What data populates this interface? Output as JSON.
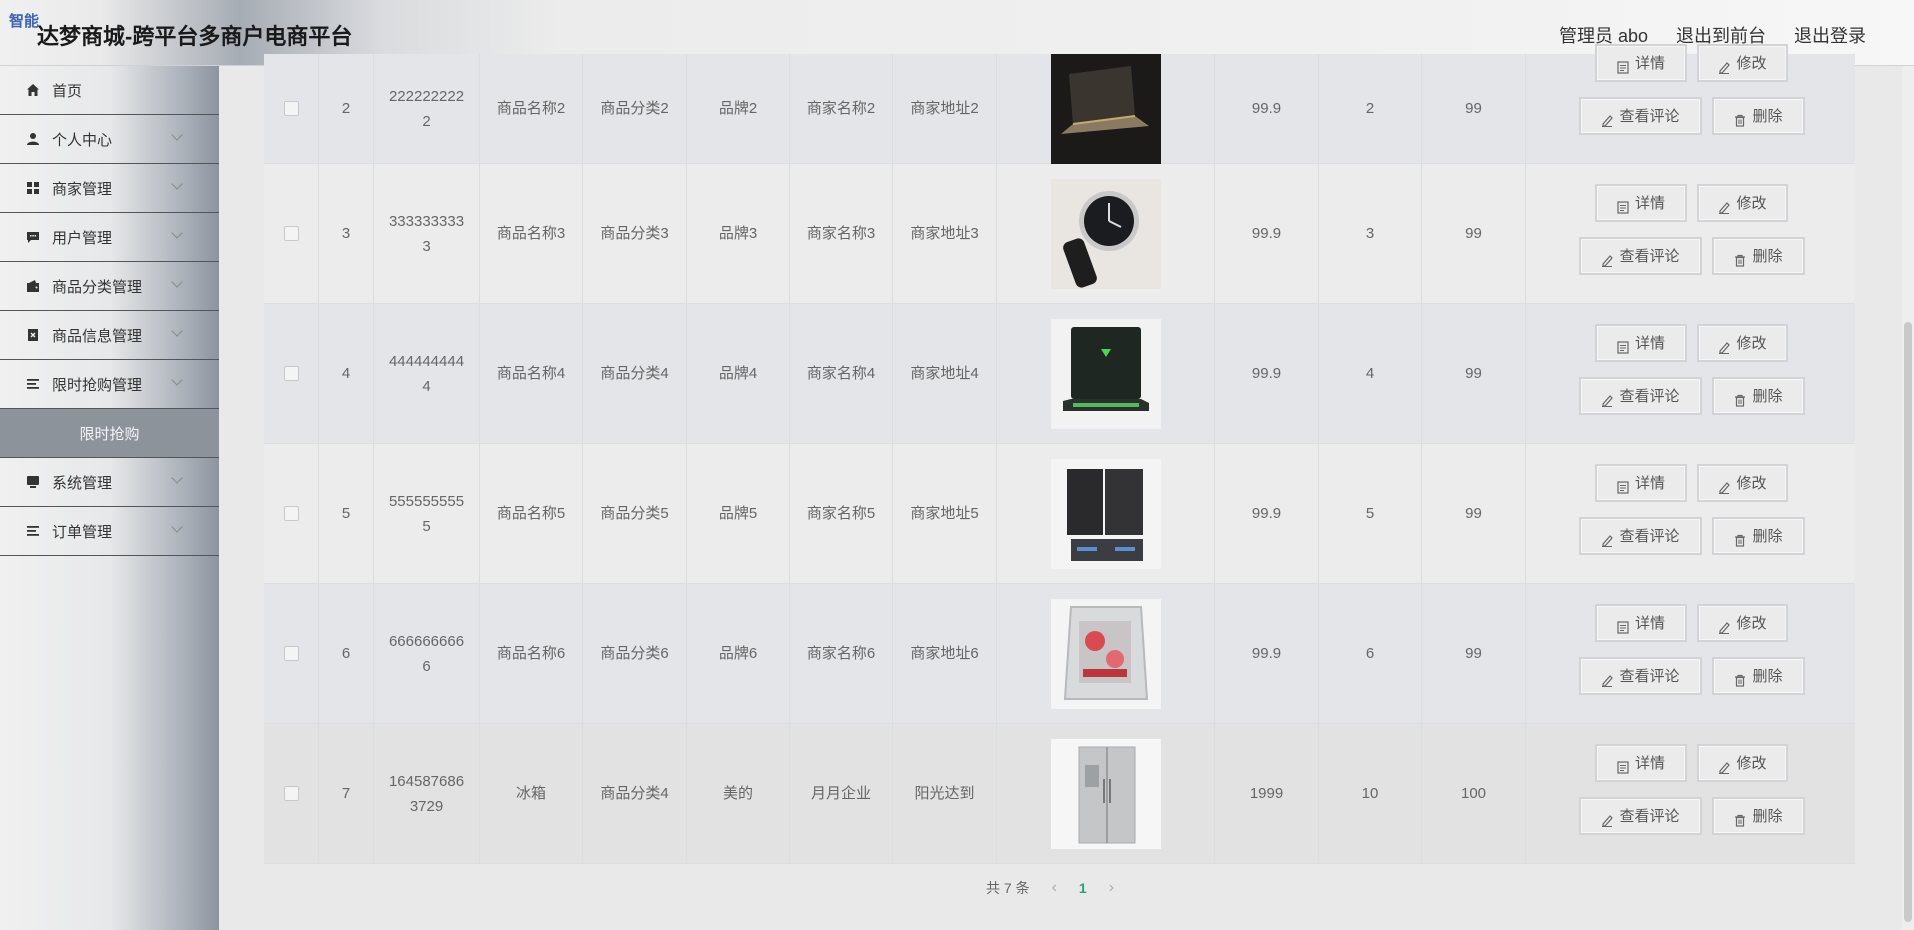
{
  "header": {
    "badge": "智能",
    "title": "达梦商城-跨平台多商户电商平台",
    "admin": "管理员 abo",
    "to_front": "退出到前台",
    "logout": "退出登录"
  },
  "sidebar": {
    "items": [
      {
        "label": "首页",
        "icon": "home-icon"
      },
      {
        "label": "个人中心",
        "icon": "user-icon"
      },
      {
        "label": "商家管理",
        "icon": "grid-icon"
      },
      {
        "label": "用户管理",
        "icon": "chat-icon"
      },
      {
        "label": "商品分类管理",
        "icon": "wallet-icon"
      },
      {
        "label": "商品信息管理",
        "icon": "doc-icon"
      },
      {
        "label": "限时抢购管理",
        "icon": "list-icon"
      },
      {
        "label": "系统管理",
        "icon": "monitor-icon"
      },
      {
        "label": "订单管理",
        "icon": "list-icon"
      }
    ],
    "sub_item": "限时抢购"
  },
  "buttons": {
    "detail": "详情",
    "edit": "修改",
    "comments": "查看评论",
    "delete": "删除"
  },
  "rows": [
    {
      "idx": "2",
      "code": [
        "222222222",
        "2"
      ],
      "name": "商品名称2",
      "category": "商品分类2",
      "brand": "品牌2",
      "merchant": "商家名称2",
      "address": "商家地址2",
      "image": "laptop",
      "price": "99.9",
      "qty": "2",
      "col3": "99"
    },
    {
      "idx": "3",
      "code": [
        "333333333",
        "3"
      ],
      "name": "商品名称3",
      "category": "商品分类3",
      "brand": "品牌3",
      "merchant": "商家名称3",
      "address": "商家地址3",
      "image": "watch",
      "price": "99.9",
      "qty": "3",
      "col3": "99"
    },
    {
      "idx": "4",
      "code": [
        "444444444",
        "4"
      ],
      "name": "商品名称4",
      "category": "商品分类4",
      "brand": "品牌4",
      "merchant": "商家名称4",
      "address": "商家地址4",
      "image": "gaming-laptop",
      "price": "99.9",
      "qty": "4",
      "col3": "99"
    },
    {
      "idx": "5",
      "code": [
        "555555555",
        "5"
      ],
      "name": "商品名称5",
      "category": "商品分类5",
      "brand": "品牌5",
      "merchant": "商家名称5",
      "address": "商家地址5",
      "image": "speakers",
      "price": "99.9",
      "qty": "5",
      "col3": "99"
    },
    {
      "idx": "6",
      "code": [
        "666666666",
        "6"
      ],
      "name": "商品名称6",
      "category": "商品分类6",
      "brand": "品牌6",
      "merchant": "商家名称6",
      "address": "商家地址6",
      "image": "pc-case",
      "price": "99.9",
      "qty": "6",
      "col3": "99"
    },
    {
      "idx": "7",
      "code": [
        "164587686",
        "3729"
      ],
      "name": "冰箱",
      "category": "商品分类4",
      "brand": "美的",
      "merchant": "月月企业",
      "address": "阳光达到",
      "image": "fridge",
      "price": "1999",
      "qty": "10",
      "col3": "100"
    }
  ],
  "pager": {
    "total": "共 7 条",
    "current": "1",
    "prev": "‹",
    "next": "›"
  }
}
